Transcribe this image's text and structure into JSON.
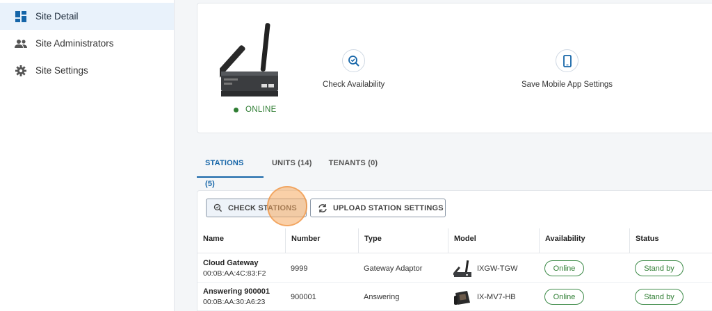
{
  "sidebar": {
    "items": [
      {
        "label": "Site Detail",
        "icon": "dashboard-icon",
        "active": true
      },
      {
        "label": "Site Administrators",
        "icon": "people-icon",
        "active": false
      },
      {
        "label": "Site Settings",
        "icon": "gear-icon",
        "active": false
      }
    ]
  },
  "device": {
    "status": "ONLINE",
    "status_color": "#2e7d32"
  },
  "actions": {
    "check_availability": "Check Availability",
    "save_mobile": "Save Mobile App Settings"
  },
  "tabs": [
    {
      "label": "STATIONS (5)",
      "active": true
    },
    {
      "label": "UNITS (14)",
      "active": false
    },
    {
      "label": "TENANTS (0)",
      "active": false
    }
  ],
  "toolbar": {
    "check_stations": "CHECK STATIONS",
    "upload_settings": "UPLOAD STATION SETTINGS"
  },
  "table": {
    "headers": [
      "Name",
      "Number",
      "Type",
      "Model",
      "Availability",
      "Status"
    ],
    "rows": [
      {
        "name": "Cloud Gateway",
        "mac": "00:0B:AA:4C:83:F2",
        "number": "9999",
        "type": "Gateway Adaptor",
        "model": "IXGW-TGW",
        "availability": "Online",
        "status": "Stand by"
      },
      {
        "name": "Answering 900001",
        "mac": "00:0B:AA:30:A6:23",
        "number": "900001",
        "type": "Answering",
        "model": "IX-MV7-HB",
        "availability": "Online",
        "status": "Stand by"
      }
    ]
  },
  "colors": {
    "accent": "#1565a8",
    "online": "#2e7d32",
    "highlight": "#f6aa60"
  }
}
